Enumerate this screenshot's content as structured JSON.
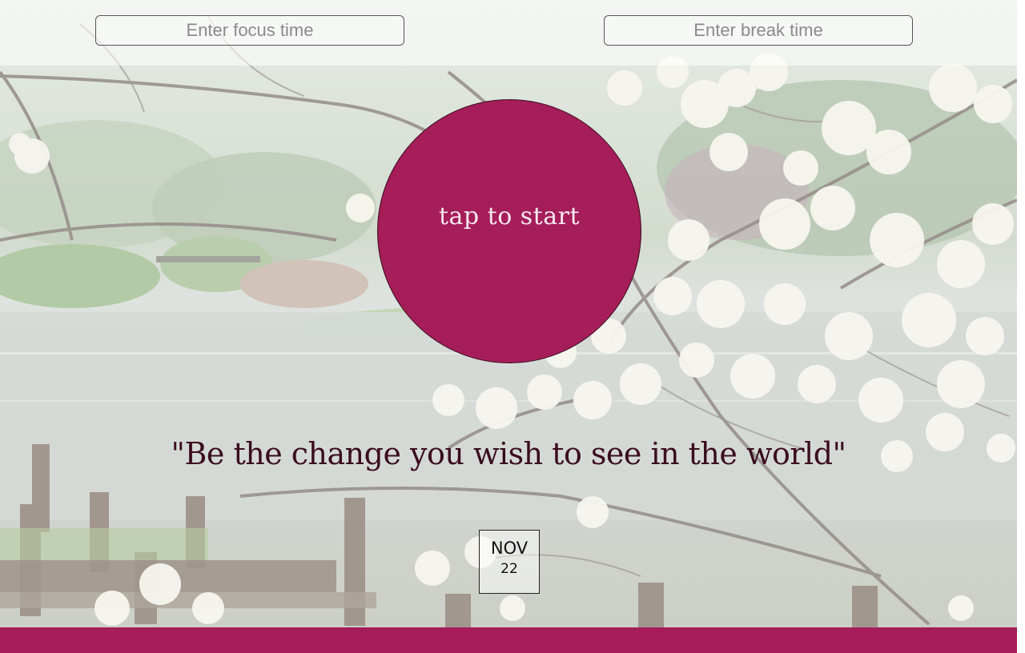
{
  "inputs": {
    "focus_placeholder": "Enter focus time",
    "break_placeholder": "Enter break time"
  },
  "timer": {
    "label": "tap to start"
  },
  "quote": {
    "text": "\"Be the change you wish to see in the world\""
  },
  "date": {
    "month": "NOV",
    "day": "22"
  },
  "colors": {
    "accent": "#a51d59",
    "quote_text": "#3a0d1d",
    "label_text": "#f7e8ee"
  },
  "background": {
    "icon": "garden-lake-blossom-image"
  }
}
